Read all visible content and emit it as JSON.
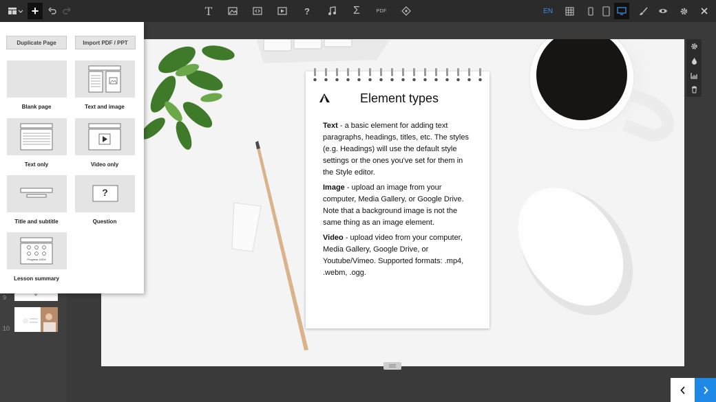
{
  "toolbar": {
    "language": "EN",
    "pdf_label": "PDF",
    "text_tool_label": "T",
    "question_tool_label": "?",
    "formula_tool_label": "Σ",
    "icons": [
      "layout-menu-icon",
      "add-icon",
      "undo-icon",
      "redo-icon",
      "text-icon",
      "image-icon",
      "embed-icon",
      "video-icon",
      "question-icon",
      "audio-icon",
      "formula-icon",
      "pdf-icon",
      "interactive-icon",
      "grid-icon",
      "mobile-icon",
      "tablet-icon",
      "desktop-icon",
      "brush-icon",
      "preview-icon",
      "settings-icon",
      "close-icon"
    ],
    "active_device": "desktop"
  },
  "add_panel": {
    "duplicate_label": "Duplicate Page",
    "import_label": "Import PDF / PPT",
    "templates": [
      {
        "label": "Blank page"
      },
      {
        "label": "Text and image"
      },
      {
        "label": "Text only"
      },
      {
        "label": "Video only"
      },
      {
        "label": "Title and subtitle"
      },
      {
        "label": "Question"
      },
      {
        "label": "Lesson summary"
      }
    ],
    "question_glyph": "?",
    "progress_text": "Progress 100%"
  },
  "slides": {
    "numbers": [
      "9",
      "10"
    ]
  },
  "notepad": {
    "title": "Element types",
    "sections": [
      {
        "term": "Text",
        "text": " - a basic element for adding text paragraphs, headings, titles, etc. The styles (e.g. Headings) will use the default style settings or the ones you've set for them in the Style editor."
      },
      {
        "term": "Image",
        "text": " - upload an image from your computer, Media Gallery, or Google Drive. Note that a background image is not the same thing as an image element."
      },
      {
        "term": "Video",
        "text": " - upload video from your computer, Media Gallery, Google Drive, or Youtube/Vimeo. Supported formats: .mp4, .webm, .ogg."
      }
    ]
  },
  "side_tools": {
    "icons": [
      "gear-icon",
      "drop-icon",
      "chart-icon",
      "trash-icon"
    ]
  },
  "nav": {
    "prev_icon": "chevron-left-icon",
    "next_icon": "chevron-right-icon"
  },
  "colors": {
    "accent": "#1e88e5",
    "toolbar_bg": "#2b2b2b",
    "language_text": "#3d8fe0"
  }
}
